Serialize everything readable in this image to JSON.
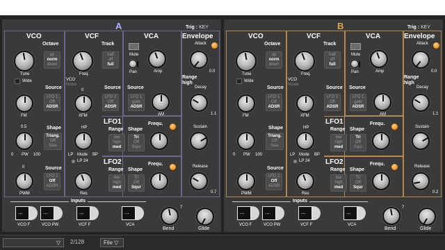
{
  "status": {
    "page": "2/128",
    "menu": "File",
    "dropdown_arrow": "▽"
  },
  "synth": {
    "trig_label": "Trig :",
    "trig_value": "KEY",
    "vco": {
      "title": "VCO",
      "octave": "Octave",
      "octave_opts": [
        "up",
        "norm",
        "down"
      ],
      "octave_sel": 1,
      "tune": "Tune",
      "wide": "Wide",
      "source": "Source",
      "src1_opts": [
        "LFO 1",
        "Off",
        "ADSR"
      ],
      "src1_sel": 2,
      "fm": "FM",
      "shape": "Shape",
      "shape_val": "0.5",
      "shape_opts": [
        "Triang.",
        "Off",
        "Saw"
      ],
      "shape_sel": 0,
      "pw": "PW",
      "pw_min": "0",
      "pw_max": "100",
      "src2_val": "0",
      "src2_opts": [
        "LFO 2",
        "Off",
        "ADSR"
      ],
      "src2_sel": 1,
      "pwm": "PWM"
    },
    "vcf": {
      "title": "VCF",
      "track": "Track",
      "track_opts": [
        "half",
        "off",
        "full"
      ],
      "track_sel": 2,
      "freq": "Freq.",
      "vco_noise": [
        "VCO",
        "Noise"
      ],
      "source": "Source",
      "src_val": "0",
      "src_opts": [
        "LFO 2",
        "Off",
        "ADSR"
      ],
      "src_sel": 2,
      "xfm": "XFM",
      "hp": "HP",
      "lp": "LP",
      "mode": "Mode",
      "bp": "BP",
      "lp24": "LP 24",
      "res": "Res"
    },
    "vca": {
      "title": "VCA",
      "mute": "Mute",
      "pan": "Pan",
      "amp": "Amp",
      "source": "Source",
      "src_opts": [
        "LFO 1",
        "gate",
        "ADSR"
      ],
      "src_sel": 2,
      "am": "AM"
    },
    "lfo1": {
      "title": "LFO1",
      "range": "Range",
      "range_opts": [
        "low",
        "high",
        "med"
      ],
      "range_sel": 2,
      "shape": "Shape",
      "shape_opts": [
        "Tri",
        "Off",
        "Squr"
      ],
      "shape_sel": 0,
      "frequ": "Frequ."
    },
    "lfo2": {
      "title": "LFO2",
      "range": "Range",
      "range_opts": [
        "low",
        "high",
        "med"
      ],
      "range_sel": 2,
      "shape": "Shape",
      "shape_opts": [
        "Tri",
        "Off",
        "Squr"
      ],
      "shape_sel": 2,
      "frequ": "Frequ."
    },
    "env": {
      "title": "Envelope",
      "attack": "Attack",
      "attack_val": "0.0",
      "range": "Range",
      "range_val": "high",
      "decay": "Decay",
      "decay_val": "1.1",
      "sustain": "Sustain",
      "release": "Release",
      "release_val": "0.7"
    },
    "inputs": {
      "title": "Inputs",
      "labels": [
        "VCO F",
        "VCO PW",
        "VCF F",
        "VCA"
      ]
    },
    "bend": "Bend",
    "bend_val": "7",
    "glide": "Glide"
  },
  "panels": [
    {
      "letter": "A",
      "release_val": "0.7",
      "accent": "#aeb2ff",
      "border": "#6a6a8c"
    },
    {
      "letter": "B",
      "release_val": "0.2",
      "accent": "#e0a556",
      "border": "#b7894e"
    }
  ]
}
